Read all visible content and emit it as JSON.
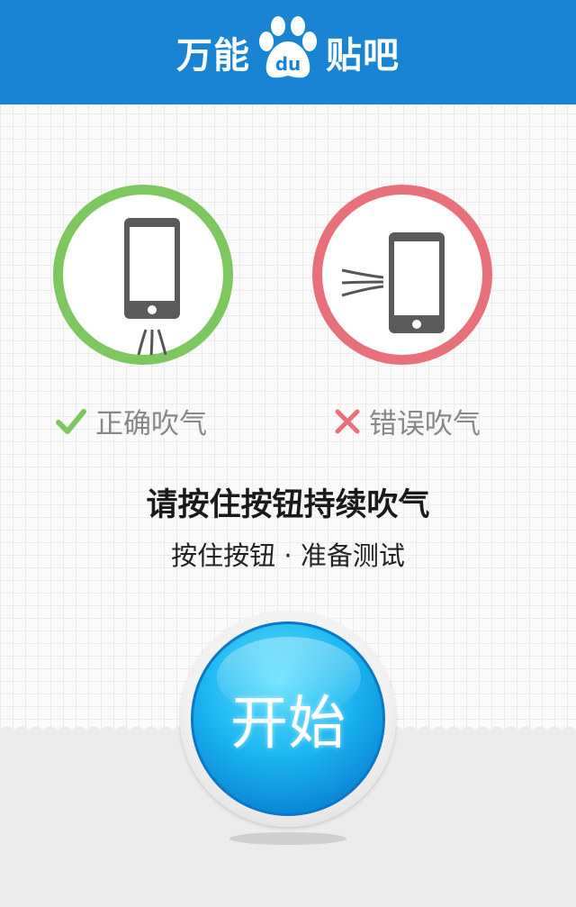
{
  "header": {
    "logo_left": "万能",
    "logo_badge": "du",
    "logo_right": "贴吧",
    "bg_color": "#1a84d4"
  },
  "examples": {
    "correct": {
      "label": "正确吹气",
      "icon": "check-icon",
      "color": "#7cc85e"
    },
    "wrong": {
      "label": "错误吹气",
      "icon": "cross-icon",
      "color": "#e8707a"
    }
  },
  "instructions": {
    "title": "请按住按钮持续吹气",
    "subtitle": "按住按钮 · 准备测试"
  },
  "start_button": {
    "label": "开始",
    "color": "#1cb6f0"
  }
}
